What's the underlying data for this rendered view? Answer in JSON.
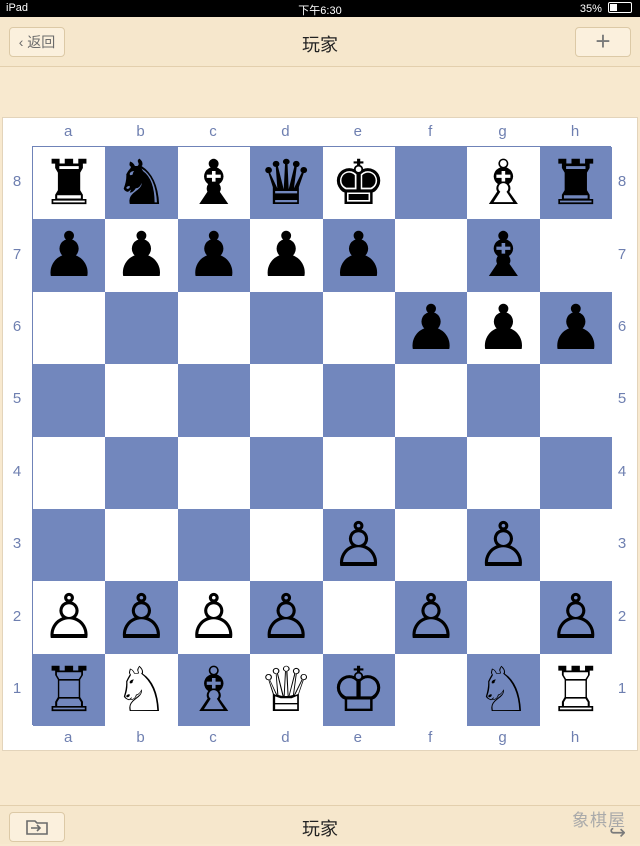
{
  "status_bar": {
    "device": "iPad",
    "time": "下午6:30",
    "battery": "35%"
  },
  "nav": {
    "back_label": "‹ 返回",
    "title": "玩家",
    "add_label": "+"
  },
  "board": {
    "files_top": [
      "a",
      "b",
      "c",
      "d",
      "e",
      "f",
      "g",
      "h"
    ],
    "files_bottom": [
      "a",
      "b",
      "c",
      "d",
      "e",
      "f",
      "g",
      "h"
    ],
    "ranks_left": [
      "8",
      "7",
      "6",
      "5",
      "4",
      "3",
      "2",
      "1"
    ],
    "ranks_right": [
      "8",
      "7",
      "6",
      "5",
      "4",
      "3",
      "2",
      "1"
    ],
    "colors": {
      "light": "#ffffff",
      "dark": "#7287bd",
      "coord": "#6e7fb0"
    },
    "position_fen": "rnbqk1Br/ppppp1b1/5ppp/8/8/4P1P1/PPPPP1PP/RNBQK1NR",
    "pieces": [
      {
        "square": "a8",
        "piece": "black-rook",
        "glyph": "♜"
      },
      {
        "square": "b8",
        "piece": "black-knight",
        "glyph": "♞"
      },
      {
        "square": "c8",
        "piece": "black-bishop",
        "glyph": "♝"
      },
      {
        "square": "d8",
        "piece": "black-queen",
        "glyph": "♛"
      },
      {
        "square": "e8",
        "piece": "black-king",
        "glyph": "♚"
      },
      {
        "square": "g8",
        "piece": "white-bishop",
        "glyph": "♗"
      },
      {
        "square": "h8",
        "piece": "black-rook",
        "glyph": "♜"
      },
      {
        "square": "a7",
        "piece": "black-pawn",
        "glyph": "♟"
      },
      {
        "square": "b7",
        "piece": "black-pawn",
        "glyph": "♟"
      },
      {
        "square": "c7",
        "piece": "black-pawn",
        "glyph": "♟"
      },
      {
        "square": "d7",
        "piece": "black-pawn",
        "glyph": "♟"
      },
      {
        "square": "e7",
        "piece": "black-pawn",
        "glyph": "♟"
      },
      {
        "square": "g7",
        "piece": "black-bishop",
        "glyph": "♝"
      },
      {
        "square": "f6",
        "piece": "black-pawn",
        "glyph": "♟"
      },
      {
        "square": "g6",
        "piece": "black-pawn",
        "glyph": "♟"
      },
      {
        "square": "h6",
        "piece": "black-pawn",
        "glyph": "♟"
      },
      {
        "square": "e3",
        "piece": "white-pawn",
        "glyph": "♙"
      },
      {
        "square": "g3",
        "piece": "white-pawn",
        "glyph": "♙"
      },
      {
        "square": "a2",
        "piece": "white-pawn",
        "glyph": "♙"
      },
      {
        "square": "b2",
        "piece": "white-pawn",
        "glyph": "♙"
      },
      {
        "square": "c2",
        "piece": "white-pawn",
        "glyph": "♙"
      },
      {
        "square": "d2",
        "piece": "white-pawn",
        "glyph": "♙"
      },
      {
        "square": "f2",
        "piece": "white-pawn",
        "glyph": "♙"
      },
      {
        "square": "h2",
        "piece": "white-pawn",
        "glyph": "♙"
      },
      {
        "square": "a1",
        "piece": "white-rook",
        "glyph": "♖"
      },
      {
        "square": "b1",
        "piece": "white-knight",
        "glyph": "♘"
      },
      {
        "square": "c1",
        "piece": "white-bishop",
        "glyph": "♗"
      },
      {
        "square": "d1",
        "piece": "white-queen",
        "glyph": "♕"
      },
      {
        "square": "e1",
        "piece": "white-king",
        "glyph": "♔"
      },
      {
        "square": "g1",
        "piece": "white-knight",
        "glyph": "♘"
      },
      {
        "square": "h1",
        "piece": "white-rook",
        "glyph": "♖"
      }
    ]
  },
  "bottom_bar": {
    "title": "玩家",
    "watermark": "象棋屋",
    "folder_icon": "folder-export-icon",
    "share_icon": "share-arrow-icon"
  }
}
